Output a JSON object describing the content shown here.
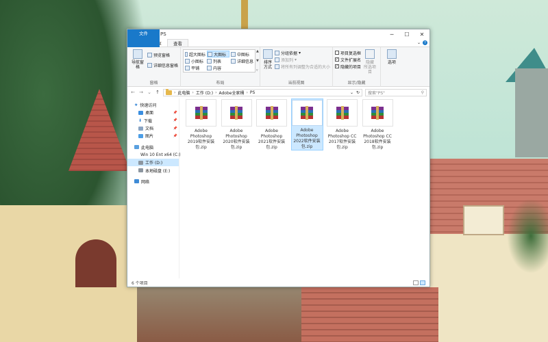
{
  "window": {
    "title": "PS",
    "controls": {
      "minimize": "─",
      "maximize": "☐",
      "close": "✕"
    }
  },
  "ribbon_tabs": [
    {
      "label": "文件"
    },
    {
      "label": "主页"
    },
    {
      "label": "共享"
    },
    {
      "label": "查看"
    }
  ],
  "ribbon": {
    "panes": {
      "nav_pane": "导航窗格",
      "preview_pane": "预览窗格",
      "details_pane": "详细信息窗格",
      "label": "窗格"
    },
    "layout": {
      "items": [
        "超大图标",
        "大图标",
        "中图标",
        "小图标",
        "列表",
        "详细信息",
        "平铺",
        "内容"
      ],
      "selected_index": 1,
      "label": "布局"
    },
    "current_view": {
      "sort_by": "排序方式",
      "group_by": "分组依据",
      "add_columns": "添加列",
      "fit_columns": "将所有列调整为合适的大小",
      "label": "当前视图"
    },
    "show_hide": {
      "checkbox_items": [
        {
          "label": "项目复选框",
          "checked": false
        },
        {
          "label": "文件扩展名",
          "checked": true
        },
        {
          "label": "隐藏的项目",
          "checked": true
        }
      ],
      "hide_selected": "隐藏\n所选项目",
      "label": "显示/隐藏"
    },
    "options": "选项"
  },
  "address": {
    "path": [
      "此电脑",
      "工作 (D:)",
      "Adobe全家桶",
      "PS"
    ],
    "search_placeholder": "搜索\"PS\""
  },
  "nav": {
    "quick_access": "快速访问",
    "quick_items": [
      "桌面",
      "下载",
      "文档",
      "图片"
    ],
    "this_pc": "此电脑",
    "drives": [
      "Win 10 Ent x64 (C:)",
      "工作 (D:)",
      "本地磁盘 (E:)"
    ],
    "selected_drive_index": 1,
    "network": "网络"
  },
  "files": [
    {
      "name": "Adobe Photoshop 2019软件安装包.zip",
      "selected": false
    },
    {
      "name": "Adobe Photoshop 2020软件安装包.zip",
      "selected": false
    },
    {
      "name": "Adobe Photoshop 2021软件安装包.zip",
      "selected": false
    },
    {
      "name": "Adobe Photoshop 2022软件安装包.zip",
      "selected": true
    },
    {
      "name": "Adobe Photoshop CC 2017软件安装包.zip",
      "selected": false
    },
    {
      "name": "Adobe Photoshop CC 2018软件安装包.zip",
      "selected": false
    }
  ],
  "status": {
    "item_count": "6 个项目"
  },
  "colors": {
    "accent": "#1979ca",
    "selection": "#cce8ff",
    "folder": "#e6b84c"
  }
}
